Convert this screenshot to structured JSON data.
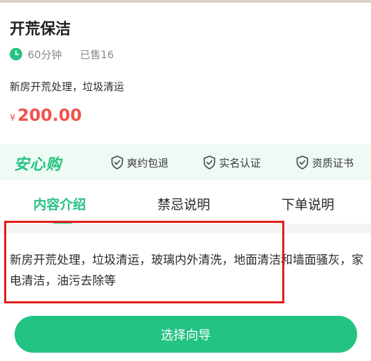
{
  "service": {
    "title": "开荒保洁",
    "duration": "60分钟",
    "sold": "已售16",
    "short_desc": "新房开荒处理，垃圾清运",
    "price_currency": "¥",
    "price_amount": "200.00"
  },
  "guarantee": {
    "brand": "安心购",
    "items": [
      {
        "label": "爽约包退",
        "icon": "shield-check-icon"
      },
      {
        "label": "实名认证",
        "icon": "shield-check-icon"
      },
      {
        "label": "资质证书",
        "icon": "shield-check-icon"
      }
    ]
  },
  "tabs": [
    {
      "label": "内容介绍",
      "active": true
    },
    {
      "label": "禁忌说明",
      "active": false
    },
    {
      "label": "下单说明",
      "active": false
    }
  ],
  "content": {
    "text": "新房开荒处理，垃圾清运，玻璃内外清洗，地面清洁和墙面骚灰，家电清洁，油污去除等"
  },
  "action": {
    "button_label": "选择向导"
  },
  "colors": {
    "accent": "#26c281",
    "price": "#f2524b",
    "highlight_border": "#e21b1b"
  }
}
